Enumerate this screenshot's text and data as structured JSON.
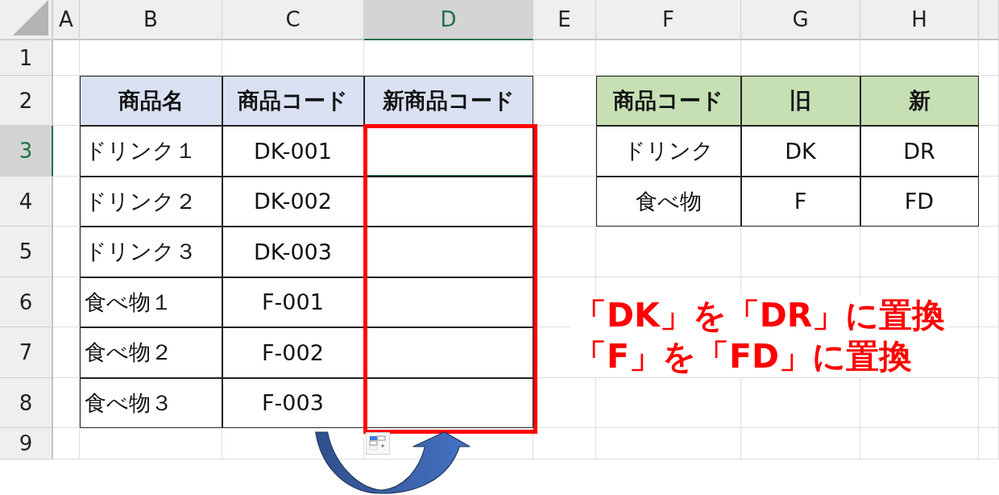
{
  "column_headers": [
    {
      "label": "A",
      "selected": false
    },
    {
      "label": "B",
      "selected": false
    },
    {
      "label": "C",
      "selected": false
    },
    {
      "label": "D",
      "selected": true
    },
    {
      "label": "E",
      "selected": false
    },
    {
      "label": "F",
      "selected": false
    },
    {
      "label": "G",
      "selected": false
    },
    {
      "label": "H",
      "selected": false
    }
  ],
  "row_headers": [
    {
      "label": "1",
      "selected": false
    },
    {
      "label": "2",
      "selected": false
    },
    {
      "label": "3",
      "selected": true
    },
    {
      "label": "4",
      "selected": false
    },
    {
      "label": "5",
      "selected": false
    },
    {
      "label": "6",
      "selected": false
    },
    {
      "label": "7",
      "selected": false
    },
    {
      "label": "8",
      "selected": false
    },
    {
      "label": "9",
      "selected": false
    }
  ],
  "product_table": {
    "columns": [
      "商品名",
      "商品コード",
      "新商品コード"
    ],
    "rows": [
      {
        "name": "ドリンク１",
        "code": "DK-001"
      },
      {
        "name": "ドリンク２",
        "code": "DK-002"
      },
      {
        "name": "ドリンク３",
        "code": "DK-003"
      },
      {
        "name": "食べ物１",
        "code": "F-001"
      },
      {
        "name": "食べ物２",
        "code": "F-002"
      },
      {
        "name": "食べ物３",
        "code": "F-003"
      }
    ]
  },
  "code_table": {
    "columns": [
      "商品コード",
      "旧",
      "新"
    ],
    "rows": [
      [
        "ドリンク",
        "DK",
        "DR"
      ],
      [
        "食べ物",
        "F",
        "FD"
      ]
    ]
  },
  "annotation": {
    "lines": [
      "「DK」を「DR」に置換",
      "「F」を「FD」に置換"
    ]
  }
}
